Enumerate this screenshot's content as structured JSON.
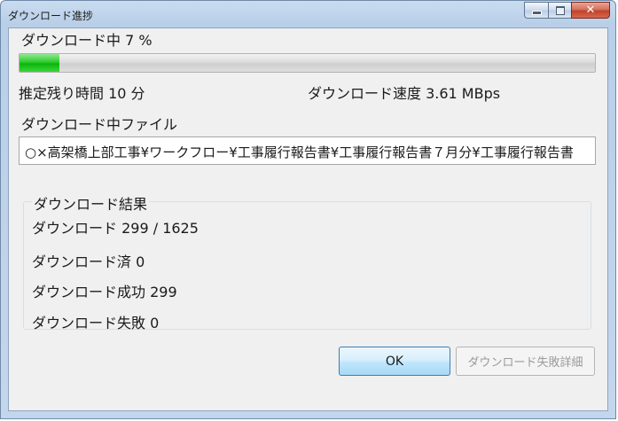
{
  "window": {
    "title": "ダウンロード進捗",
    "title_icons": [
      "minimize-icon",
      "maximize-icon",
      "close-icon"
    ],
    "close_glyph": "✕"
  },
  "status": {
    "downloading_label": "ダウンロード中 7 %",
    "progress_percent": 7,
    "remaining_time": "推定残り時間 10 分",
    "speed": "ダウンロード速度 3.61 MBps"
  },
  "file": {
    "heading": "ダウンロード中ファイル",
    "path": "○×高架橋上部工事¥ワークフロー¥工事履行報告書¥工事履行報告書７月分¥工事履行報告書"
  },
  "results": {
    "heading": "ダウンロード結果",
    "count": "ダウンロード 299 / 1625",
    "skipped": "ダウンロード済 0",
    "succeeded": "ダウンロード成功 299",
    "failed": "ダウンロード失敗 0"
  },
  "buttons": {
    "ok": "OK",
    "failure_details": "ダウンロード失敗詳細"
  },
  "colors": {
    "progress_green": "#0db40d",
    "titlebar": "#c4d6ec",
    "close_red": "#c0432b"
  }
}
